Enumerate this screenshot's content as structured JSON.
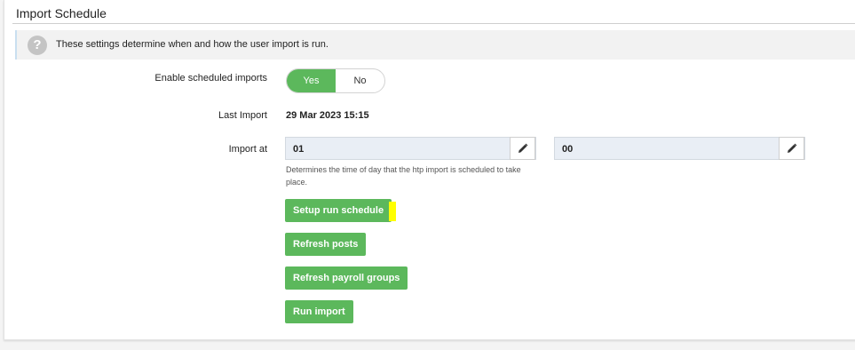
{
  "section": {
    "title": "Import Schedule",
    "info_icon": "question-icon",
    "info_text": "These settings determine when and how the user import is run."
  },
  "enable_scheduled": {
    "label": "Enable scheduled imports",
    "options": [
      "Yes",
      "No"
    ],
    "selected": "Yes"
  },
  "last_import": {
    "label": "Last Import",
    "value": "29 Mar 2023 15:15"
  },
  "import_at": {
    "label": "Import at",
    "hour": "01",
    "minute": "00",
    "edit_icon": "pencil-icon",
    "help": "Determines the time of day that the htp import is scheduled to take place."
  },
  "buttons": {
    "setup_run_schedule": "Setup run schedule",
    "refresh_posts": "Refresh posts",
    "refresh_payroll_groups": "Refresh payroll groups",
    "run_import": "Run import"
  },
  "colors": {
    "primary_green": "#5cb85c",
    "highlight": "#ffff00"
  }
}
